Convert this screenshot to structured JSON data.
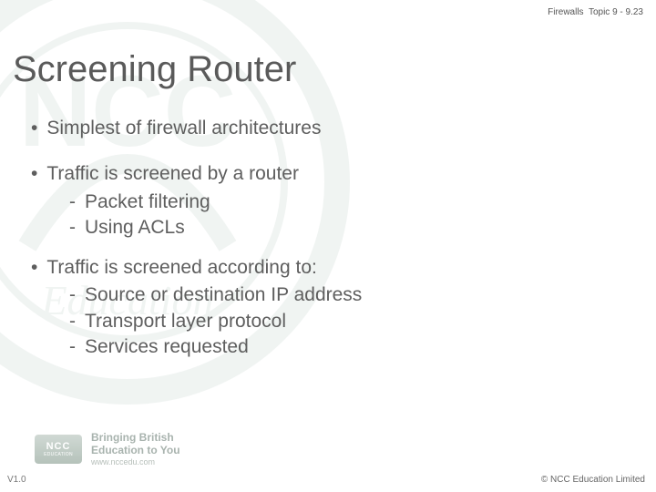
{
  "header": {
    "course": "Firewalls",
    "topic_ref": "Topic 9 - 9.23"
  },
  "title": "Screening Router",
  "bullets": [
    {
      "text": "Simplest of firewall architectures",
      "sub": []
    },
    {
      "text": "Traffic is screened by a router",
      "sub": [
        "Packet filtering",
        "Using ACLs"
      ]
    },
    {
      "text": "Traffic is screened according to:",
      "sub": [
        "Source or destination IP address",
        "Transport layer protocol",
        "Services requested"
      ]
    }
  ],
  "footer": {
    "logo_text": "NCC",
    "logo_sub": "EDUCATION",
    "tagline_l1": "Bringing British",
    "tagline_l2": "Education to You",
    "url": "www.nccedu.com",
    "version": "V1.0",
    "copyright": "©  NCC Education Limited"
  }
}
